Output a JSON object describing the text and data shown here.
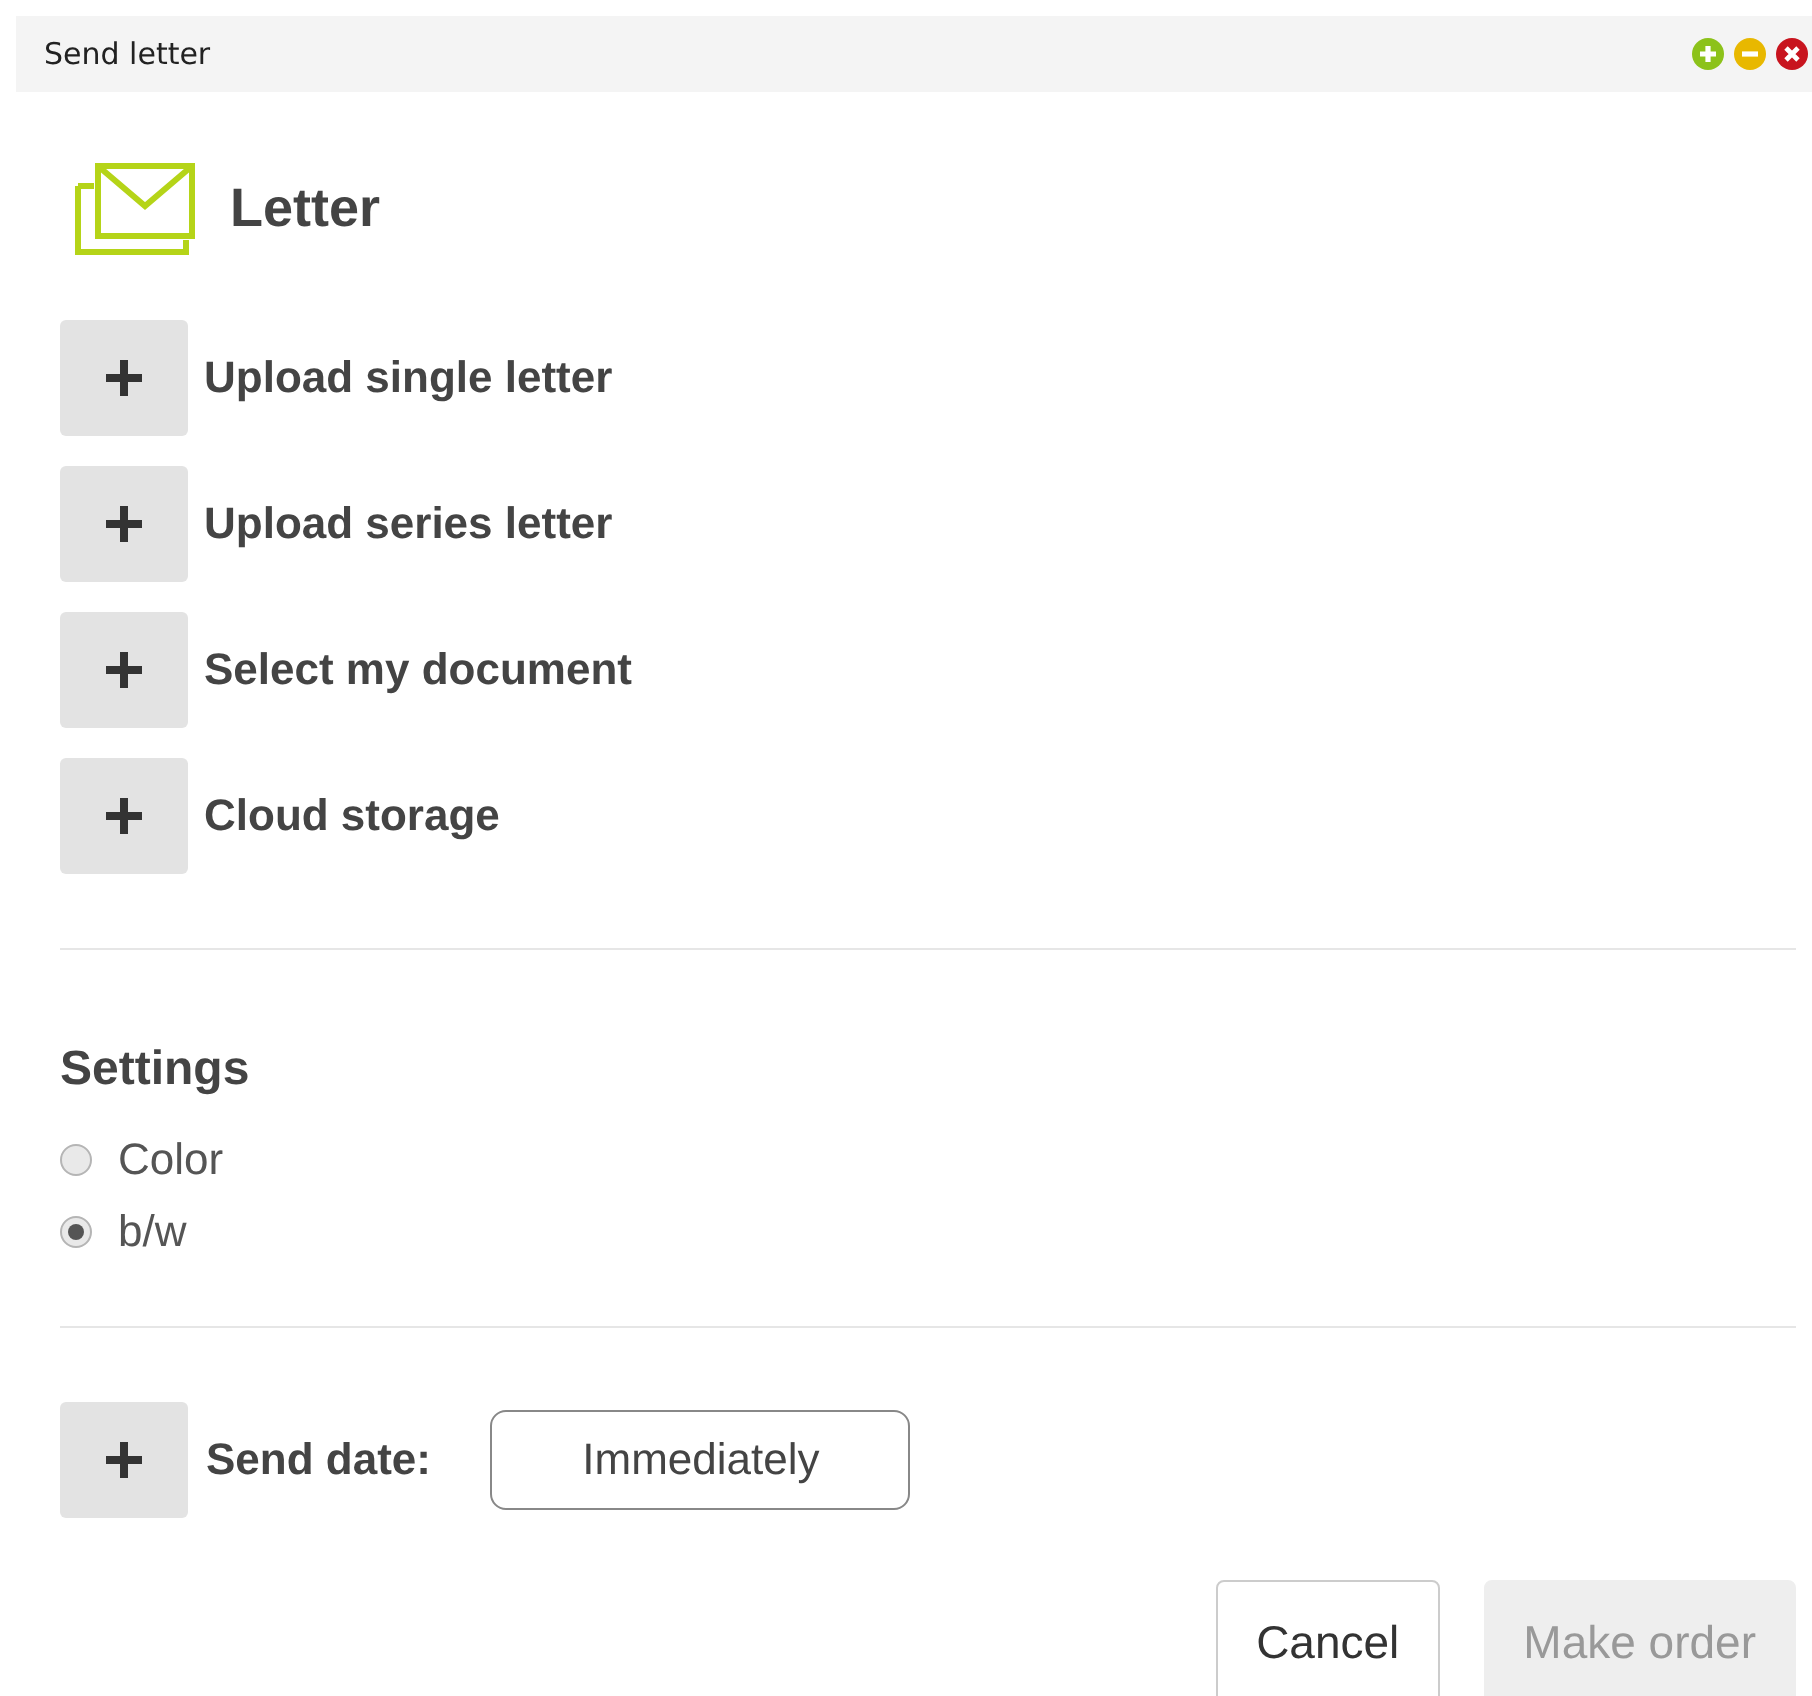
{
  "window": {
    "title": "Send letter"
  },
  "header": {
    "title": "Letter"
  },
  "upload_options": [
    {
      "label": "Upload single letter"
    },
    {
      "label": "Upload series letter"
    },
    {
      "label": "Select my document"
    },
    {
      "label": "Cloud storage"
    }
  ],
  "settings": {
    "title": "Settings",
    "options": [
      {
        "label": "Color",
        "selected": false
      },
      {
        "label": "b/w",
        "selected": true
      }
    ]
  },
  "send_date": {
    "label": "Send date:",
    "value": "Immediately"
  },
  "buttons": [
    {
      "label": "Cancel",
      "disabled": false
    },
    {
      "label": "Make order",
      "disabled": true
    }
  ]
}
